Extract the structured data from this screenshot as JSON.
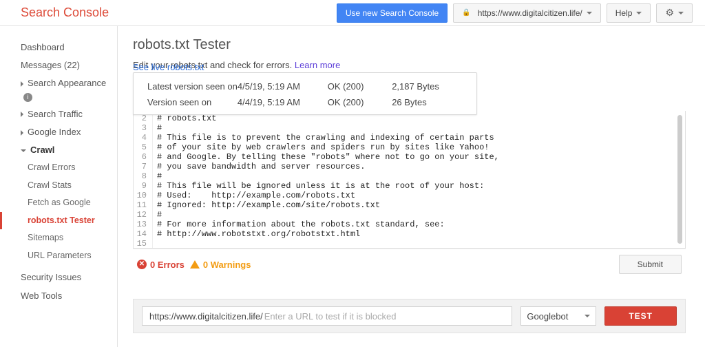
{
  "brand": "Search Console",
  "header": {
    "use_new": "Use new Search Console",
    "site": "https://www.digitalcitizen.life/",
    "help": "Help"
  },
  "sidebar": {
    "dashboard": "Dashboard",
    "messages": "Messages (22)",
    "search_appearance": "Search Appearance",
    "search_traffic": "Search Traffic",
    "google_index": "Google Index",
    "crawl": "Crawl",
    "crawl_errors": "Crawl Errors",
    "crawl_stats": "Crawl Stats",
    "fetch_as_google": "Fetch as Google",
    "robots_tester": "robots.txt Tester",
    "sitemaps": "Sitemaps",
    "url_parameters": "URL Parameters",
    "security_issues": "Security Issues",
    "web_tools": "Web Tools"
  },
  "page": {
    "title": "robots.txt Tester",
    "subtitle_a": "Edit your robots.txt and check for errors.",
    "learn_more": "Learn more",
    "see_live": "See live robots.txt",
    "errors_count": "0 Errors",
    "warnings_count": "0 Warnings",
    "submit": "Submit",
    "url_prefix": "https://www.digitalcitizen.life/",
    "url_placeholder": "Enter a URL to test if it is blocked",
    "bot": "Googlebot",
    "test": "TEST"
  },
  "versions": [
    {
      "label": "Latest version seen on",
      "ts": "4/5/19, 5:19 AM",
      "status": "OK (200)",
      "size": "2,187 Bytes"
    },
    {
      "label": "Version seen on",
      "ts": "4/4/19, 5:19 AM",
      "status": "OK (200)",
      "size": "26 Bytes"
    }
  ],
  "code_lines": [
    "# robots.txt",
    "#",
    "# This file is to prevent the crawling and indexing of certain parts",
    "# of your site by web crawlers and spiders run by sites like Yahoo!",
    "# and Google. By telling these \"robots\" where not to go on your site,",
    "# you save bandwidth and server resources.",
    "#",
    "# This file will be ignored unless it is at the root of your host:",
    "# Used:    http://example.com/robots.txt",
    "# Ignored: http://example.com/site/robots.txt",
    "#",
    "# For more information about the robots.txt standard, see:",
    "# http://www.robotstxt.org/robotstxt.html",
    ""
  ],
  "code_start_line": 2
}
